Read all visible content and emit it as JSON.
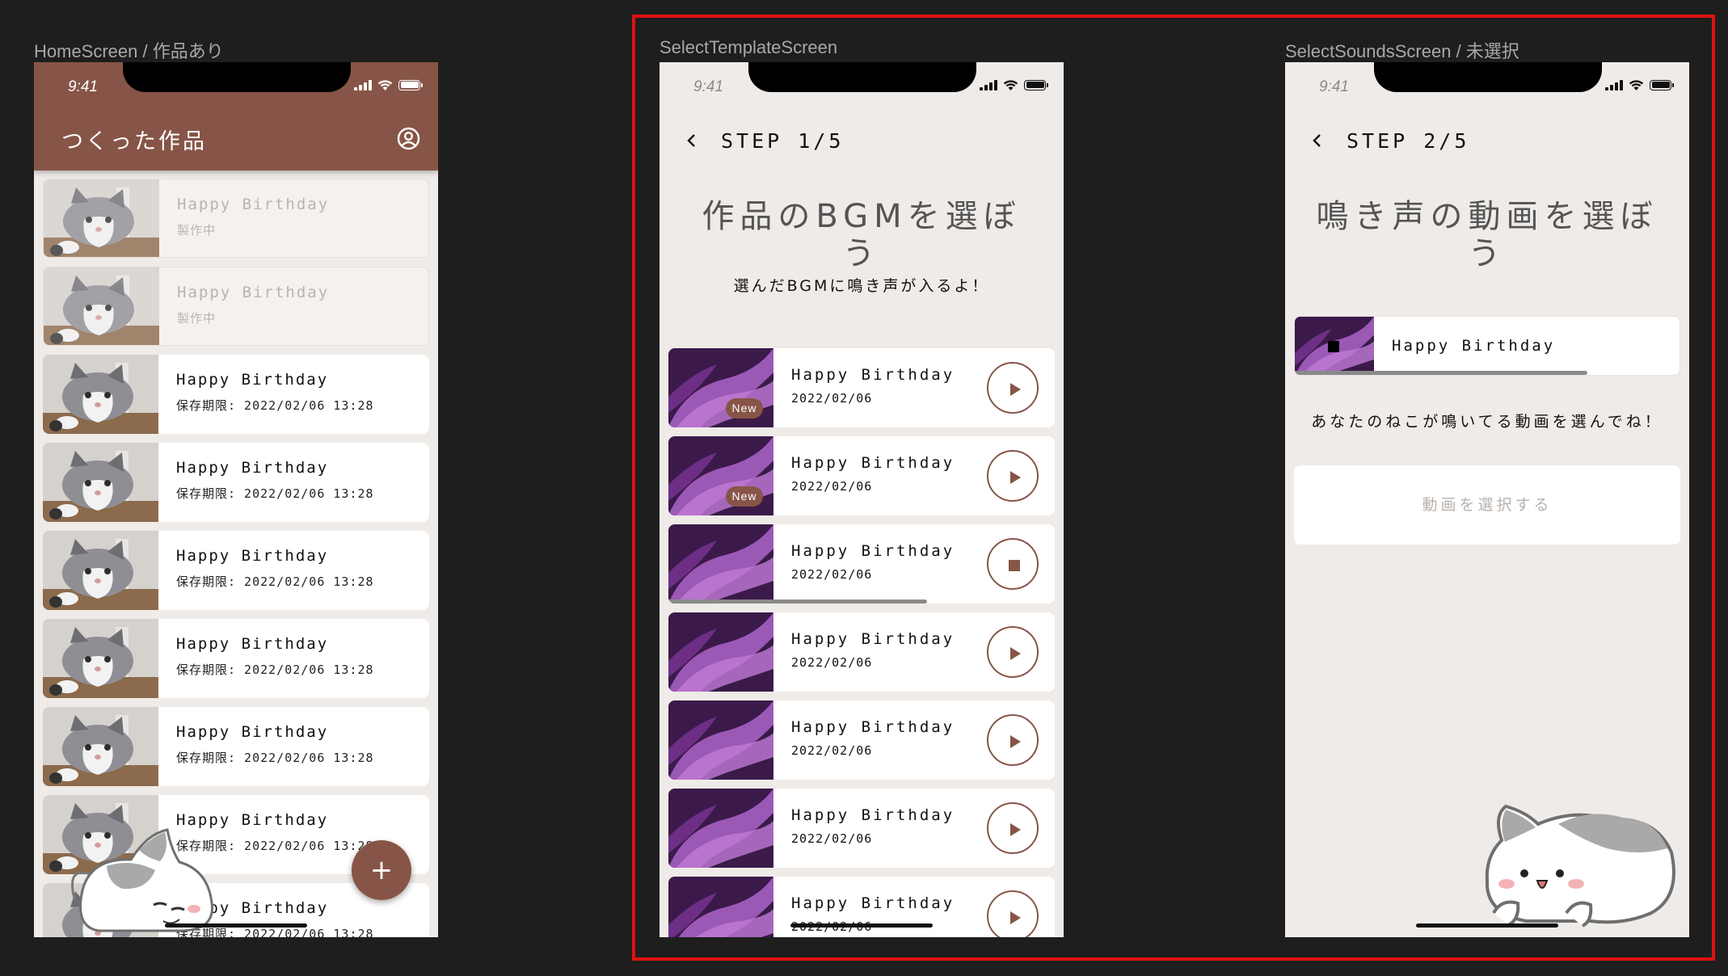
{
  "canvas": {
    "frames": [
      {
        "label": "HomeScreen / 作品あり"
      },
      {
        "label": "SelectTemplateScreen"
      },
      {
        "label": "SelectSoundsScreen / 未選択"
      }
    ]
  },
  "status_time": "9:41",
  "home": {
    "title": "つくった作品",
    "header_color": "#875547",
    "fab_label": "+",
    "works": [
      {
        "title": "Happy Birthday",
        "sub": "製作中",
        "state": "in-progress"
      },
      {
        "title": "Happy Birthday",
        "sub": "製作中",
        "state": "in-progress"
      },
      {
        "title": "Happy Birthday",
        "sub": "保存期限: 2022/02/06 13:28",
        "state": "done"
      },
      {
        "title": "Happy Birthday",
        "sub": "保存期限: 2022/02/06 13:28",
        "state": "done"
      },
      {
        "title": "Happy Birthday",
        "sub": "保存期限: 2022/02/06 13:28",
        "state": "done"
      },
      {
        "title": "Happy Birthday",
        "sub": "保存期限: 2022/02/06 13:28",
        "state": "done"
      },
      {
        "title": "Happy Birthday",
        "sub": "保存期限: 2022/02/06 13:28",
        "state": "done"
      },
      {
        "title": "Happy Birthday",
        "sub": "保存期限: 2022/02/06 13:28",
        "state": "done"
      },
      {
        "title": "Happy Birthday",
        "sub": "保存期限: 2022/02/06 13:28",
        "state": "done"
      }
    ]
  },
  "template": {
    "step": "STEP 1/5",
    "title": "作品のBGMを選ぼう",
    "subtitle": "選んだBGMに鳴き声が入るよ！",
    "items": [
      {
        "title": "Happy Birthday",
        "date": "2022/02/06",
        "badge": "New",
        "button": "play-icon",
        "progress": 0
      },
      {
        "title": "Happy Birthday",
        "date": "2022/02/06",
        "badge": "New",
        "button": "play-icon",
        "progress": 0
      },
      {
        "title": "Happy Birthday",
        "date": "2022/02/06",
        "badge": "",
        "button": "stop-icon",
        "progress": 0.67
      },
      {
        "title": "Happy Birthday",
        "date": "2022/02/06",
        "badge": "",
        "button": "play-icon",
        "progress": 0
      },
      {
        "title": "Happy Birthday",
        "date": "2022/02/06",
        "badge": "",
        "button": "play-icon",
        "progress": 0
      },
      {
        "title": "Happy Birthday",
        "date": "2022/02/06",
        "badge": "",
        "button": "play-icon",
        "progress": 0
      },
      {
        "title": "Happy Birthday",
        "date": "2022/02/06",
        "badge": "",
        "button": "play-icon",
        "progress": 0
      }
    ]
  },
  "sounds": {
    "step": "STEP 2/5",
    "title": "鳴き声の動画を選ぼう",
    "selected_bgm": {
      "title": "Happy Birthday",
      "progress": 0.76
    },
    "instruction": "あなたのねこが鳴いてる動画を選んでね！",
    "select_button": "動画を選択する"
  },
  "colors": {
    "accent": "#875547",
    "highlight": "#e01010",
    "screen_bg": "#efebe8"
  }
}
